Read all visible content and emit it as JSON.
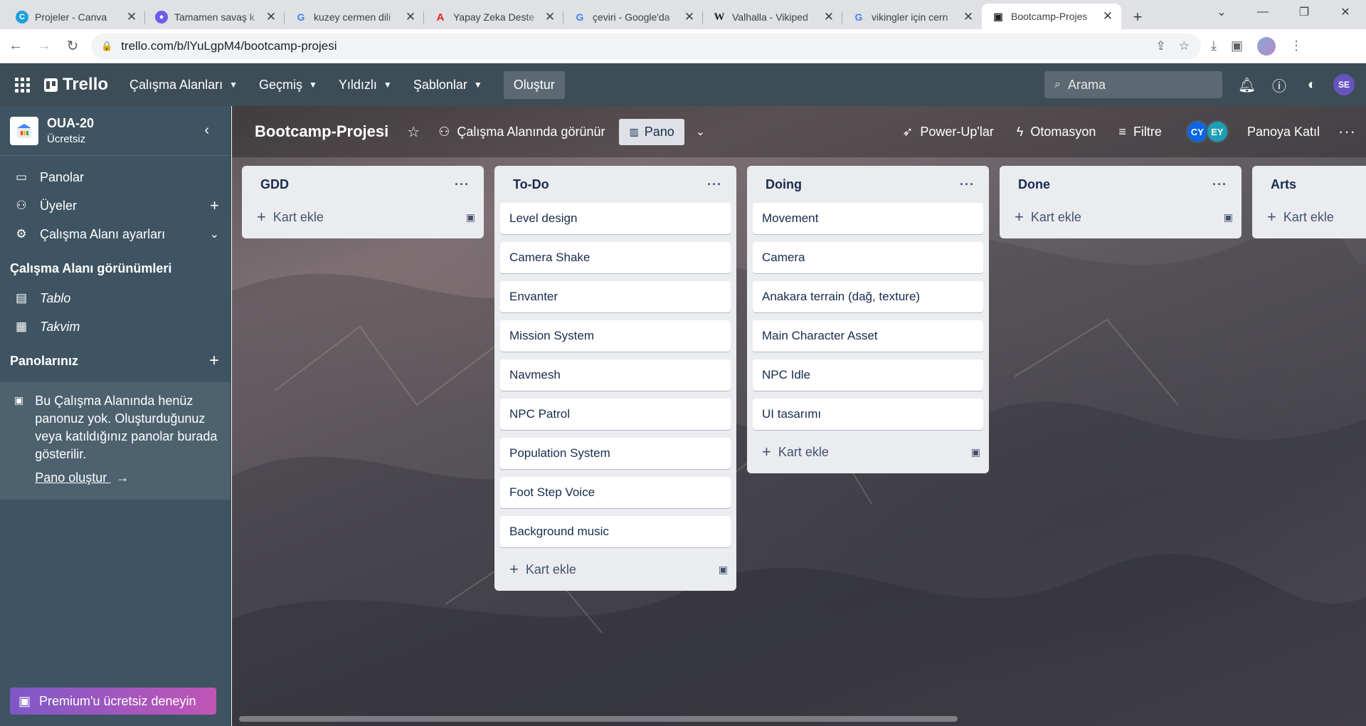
{
  "browser": {
    "tabs": [
      {
        "title": "Projeler - Canva",
        "fav_color": "#1fa0d8",
        "fav_glyph": "C"
      },
      {
        "title": "Tamamen savaş k",
        "fav_color": "#6c5ce7",
        "fav_glyph": "●"
      },
      {
        "title": "kuzey cermen dili",
        "fav_color": "#ffffff",
        "fav_glyph": "G"
      },
      {
        "title": "Yapay Zeka Deste",
        "fav_color": "#e0251b",
        "fav_glyph": "A"
      },
      {
        "title": "çeviri - Google'da",
        "fav_color": "#ffffff",
        "fav_glyph": "G"
      },
      {
        "title": "Valhalla - Vikiped",
        "fav_color": "#ffffff",
        "fav_glyph": "W"
      },
      {
        "title": "vikingler için cern",
        "fav_color": "#ffffff",
        "fav_glyph": "G"
      },
      {
        "title": "Bootcamp-Projes",
        "fav_color": "#ffffff",
        "fav_glyph": "▣"
      }
    ],
    "url": "trello.com/b/lYuLgpM4/bootcamp-projesi"
  },
  "header": {
    "logo": "Trello",
    "menus": [
      "Çalışma Alanları",
      "Geçmiş",
      "Yıldızlı",
      "Şablonlar"
    ],
    "create": "Oluştur",
    "search_placeholder": "Arama",
    "avatar": "SE"
  },
  "sidebar": {
    "workspace_name": "OUA-20",
    "workspace_plan": "Ücretsiz",
    "items": [
      {
        "label": "Panolar",
        "icon": "board-icon"
      },
      {
        "label": "Üyeler",
        "icon": "person-icon"
      },
      {
        "label": "Çalışma Alanı ayarları",
        "icon": "gear-icon"
      }
    ],
    "views_title": "Çalışma Alanı görünümleri",
    "views": [
      "Tablo",
      "Takvim"
    ],
    "boards_title": "Panolarınız",
    "empty_text": "Bu Çalışma Alanında henüz panonuz yok. Oluşturduğunuz veya katıldığınız panolar burada gösterilir.",
    "create_board": "Pano oluştur",
    "premium": "Premium'u ücretsiz deneyin"
  },
  "board": {
    "title": "Bootcamp-Projesi",
    "visibility": "Çalışma Alanında görünür",
    "view": "Pano",
    "powerups": "Power-Up'lar",
    "automation": "Otomasyon",
    "filter": "Filtre",
    "members": [
      "CY",
      "EY"
    ],
    "join": "Panoya Katıl",
    "add_card": "Kart ekle",
    "lists": [
      {
        "title": "GDD",
        "cards": []
      },
      {
        "title": "To-Do",
        "cards": [
          "Level design",
          "Camera Shake",
          "Envanter",
          "Mission System",
          "Navmesh",
          "NPC Patrol",
          "Population System",
          "Foot Step Voice",
          "Background music"
        ]
      },
      {
        "title": "Doing",
        "cards": [
          "Movement",
          "Camera",
          "Anakara terrain (dağ, texture)",
          "Main Character Asset",
          "NPC Idle",
          "UI tasarımı"
        ]
      },
      {
        "title": "Done",
        "cards": []
      },
      {
        "title": "Arts",
        "cards": []
      }
    ]
  }
}
